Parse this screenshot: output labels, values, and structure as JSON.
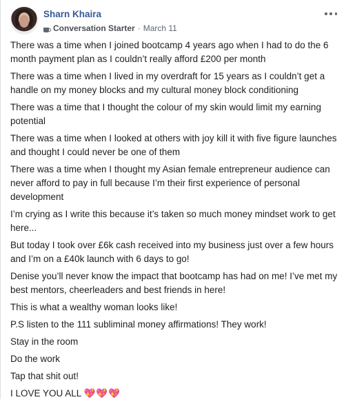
{
  "post": {
    "author": "Sharn Khaira",
    "badge": "Conversation Starter",
    "separator": "·",
    "date": "March 11",
    "paragraphs": [
      "There was a time when I joined bootcamp 4 years ago when I had to do the 6 month payment plan as I couldn’t really afford £200 per month",
      "There was a time when I lived in my overdraft for 15 years as I couldn’t get a handle on my money blocks and my cultural money block conditioning",
      "There was a time that I thought the colour of my skin would limit my earning potential",
      "There was a time when I looked at others with joy kill it with five figure launches and thought I could never be one of them",
      "There was a time when I thought my Asian female entrepreneur audience can never afford to pay in full because I’m their first experience of personal development",
      "I’m crying as I write this because it’s taken so much money mindset work to get here...",
      "But today I took over £6k cash received into my business just over a few hours and I’m on a £40k launch with 6 days to go!",
      "Denise you’ll never know the impact that bootcamp has had on me! I’ve met my best mentors, cheerleaders and best friends in here!",
      "This is what a wealthy woman looks like!",
      "P.S listen to the 111 subliminal money affirmations! They work!",
      "Stay in the room",
      "Do the work",
      "Tap that shit out!"
    ],
    "closing": "I LOVE YOU ALL",
    "closing_hearts": "💖💖💖",
    "icons": {
      "badge": "coffee-cup-icon",
      "menu": "more-options-icon"
    },
    "colors": {
      "author": "#385898",
      "meta": "#606770",
      "text": "#1c1e21"
    }
  }
}
